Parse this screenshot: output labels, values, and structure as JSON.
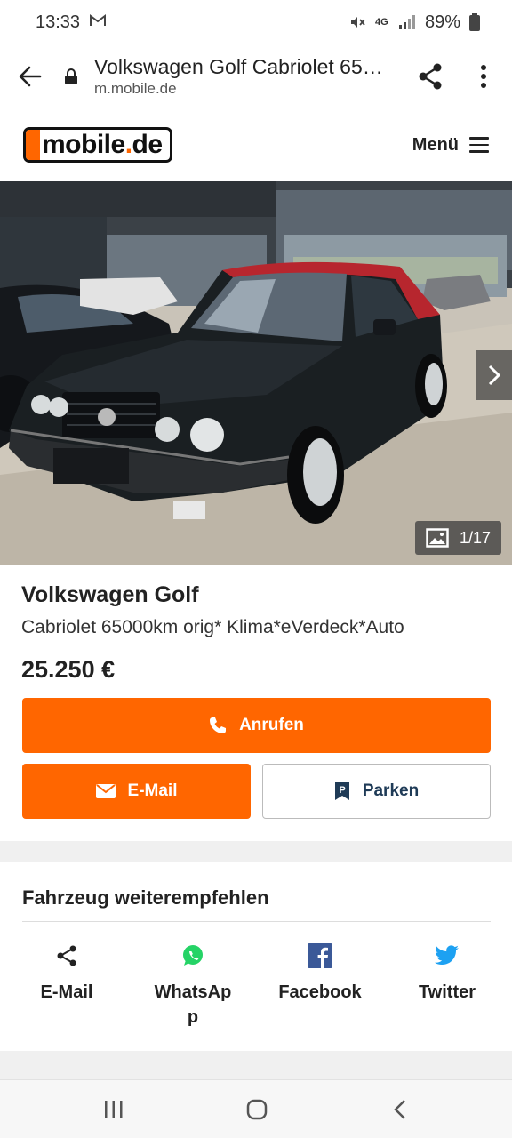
{
  "status": {
    "time": "13:33",
    "battery": "89%",
    "network": "4G"
  },
  "browser": {
    "title": "Volkswagen Golf Cabriolet 65000km orig* Klima*eVerdeck*Auto",
    "host": "m.mobile.de"
  },
  "header": {
    "logo_main": "mobile",
    "logo_dot": ".",
    "logo_tld": "de",
    "menu_label": "Menü"
  },
  "gallery": {
    "counter": "1/17"
  },
  "listing": {
    "title": "Volkswagen Golf",
    "subtitle": "Cabriolet 65000km orig* Klima*eVerdeck*Auto",
    "price": "25.250 €",
    "call_label": "Anrufen",
    "mail_label": "E-Mail",
    "park_label": "Parken"
  },
  "share": {
    "heading": "Fahrzeug weiterempfehlen",
    "items": [
      {
        "label": "E-Mail",
        "icon": "share-icon"
      },
      {
        "label": "WhatsApp",
        "icon": "whatsapp-icon"
      },
      {
        "label": "Facebook",
        "icon": "facebook-icon"
      },
      {
        "label": "Twitter",
        "icon": "twitter-icon"
      }
    ]
  },
  "colors": {
    "brand_orange": "#ff6600",
    "park_text": "#1f3b57",
    "whatsapp": "#25d366",
    "facebook": "#3b5998",
    "twitter": "#1da1f2"
  }
}
